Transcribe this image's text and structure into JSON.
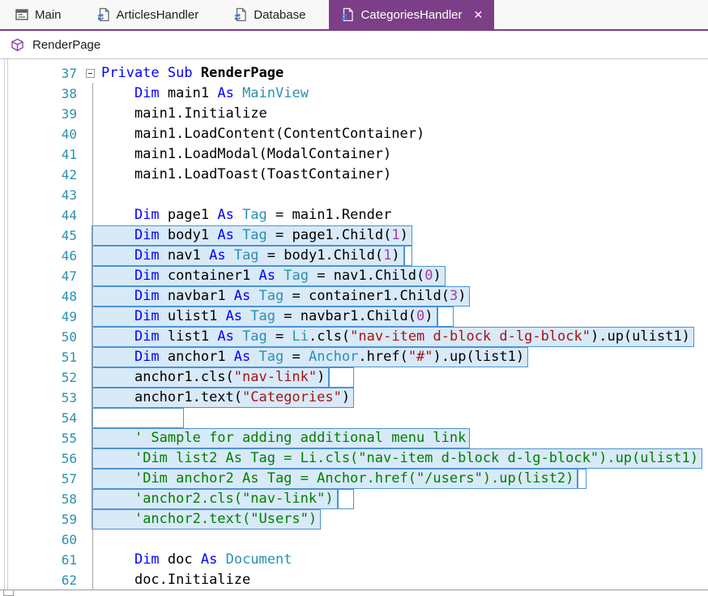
{
  "chrome": {
    "close_glyph": "✕"
  },
  "colors": {
    "accent": "#7C3E86",
    "kw": "#0000FF",
    "ty": "#2B91AF",
    "st": "#A31515",
    "cm": "#008000",
    "nm": "#A23DA0",
    "line_no": "#2B91AF",
    "sel_fill": "#D8E9F8",
    "sel_border": "#4B93D4"
  },
  "tabs": [
    {
      "label": "Main",
      "icon": "form-icon",
      "active": false
    },
    {
      "label": "ArticlesHandler",
      "icon": "vb-file-icon",
      "active": false
    },
    {
      "label": "Database",
      "icon": "vb-file-icon",
      "active": false
    },
    {
      "label": "CategoriesHandler",
      "icon": "vb-file-icon",
      "active": true
    }
  ],
  "breadcrumb": {
    "label": "RenderPage",
    "icon": "method-cube-icon"
  },
  "editor": {
    "lines": [
      {
        "no": 37,
        "fold": true,
        "indent": 0,
        "sel": false,
        "tokens": [
          [
            "kw",
            "Private"
          ],
          [
            "pl",
            " "
          ],
          [
            "kw",
            "Sub"
          ],
          [
            "pl",
            " "
          ],
          [
            "bold",
            "RenderPage"
          ]
        ]
      },
      {
        "no": 38,
        "indent": 4,
        "sel": false,
        "tokens": [
          [
            "kw",
            "Dim"
          ],
          [
            "pl",
            " main1 "
          ],
          [
            "kw",
            "As"
          ],
          [
            "pl",
            " "
          ],
          [
            "ty",
            "MainView"
          ]
        ]
      },
      {
        "no": 39,
        "indent": 4,
        "sel": false,
        "tokens": [
          [
            "pl",
            "main1.Initialize"
          ]
        ]
      },
      {
        "no": 40,
        "indent": 4,
        "sel": false,
        "tokens": [
          [
            "pl",
            "main1.LoadContent(ContentContainer)"
          ]
        ]
      },
      {
        "no": 41,
        "indent": 4,
        "sel": false,
        "tokens": [
          [
            "pl",
            "main1.LoadModal(ModalContainer)"
          ]
        ]
      },
      {
        "no": 42,
        "indent": 4,
        "sel": false,
        "tokens": [
          [
            "pl",
            "main1.LoadToast(ToastContainer)"
          ]
        ]
      },
      {
        "no": 43,
        "indent": 0,
        "sel": false,
        "tokens": []
      },
      {
        "no": 44,
        "indent": 4,
        "sel": false,
        "tokens": [
          [
            "kw",
            "Dim"
          ],
          [
            "pl",
            " page1 "
          ],
          [
            "kw",
            "As"
          ],
          [
            "pl",
            " "
          ],
          [
            "ty",
            "Tag"
          ],
          [
            "pl",
            " = main1.Render"
          ]
        ]
      },
      {
        "no": 45,
        "indent": 4,
        "sel": true,
        "tokens": [
          [
            "kw",
            "Dim"
          ],
          [
            "pl",
            " body1 "
          ],
          [
            "kw",
            "As"
          ],
          [
            "pl",
            " "
          ],
          [
            "ty",
            "Tag"
          ],
          [
            "pl",
            " = page1.Child("
          ],
          [
            "nm",
            "1"
          ],
          [
            "pl",
            ")"
          ]
        ]
      },
      {
        "no": 46,
        "indent": 4,
        "sel": true,
        "notch_ch": 1,
        "tokens": [
          [
            "kw",
            "Dim"
          ],
          [
            "pl",
            " nav1 "
          ],
          [
            "kw",
            "As"
          ],
          [
            "pl",
            " "
          ],
          [
            "ty",
            "Tag"
          ],
          [
            "pl",
            " = body1.Child("
          ],
          [
            "nm",
            "1"
          ],
          [
            "pl",
            ")"
          ]
        ]
      },
      {
        "no": 47,
        "indent": 4,
        "sel": true,
        "tokens": [
          [
            "kw",
            "Dim"
          ],
          [
            "pl",
            " container1 "
          ],
          [
            "kw",
            "As"
          ],
          [
            "pl",
            " "
          ],
          [
            "ty",
            "Tag"
          ],
          [
            "pl",
            " = nav1.Child("
          ],
          [
            "nm",
            "0"
          ],
          [
            "pl",
            ")"
          ]
        ]
      },
      {
        "no": 48,
        "indent": 4,
        "sel": true,
        "tokens": [
          [
            "kw",
            "Dim"
          ],
          [
            "pl",
            " navbar1 "
          ],
          [
            "kw",
            "As"
          ],
          [
            "pl",
            " "
          ],
          [
            "ty",
            "Tag"
          ],
          [
            "pl",
            " = container1.Child("
          ],
          [
            "nm",
            "3"
          ],
          [
            "pl",
            ")"
          ]
        ]
      },
      {
        "no": 49,
        "indent": 4,
        "sel": true,
        "notch_ch": 2,
        "tokens": [
          [
            "kw",
            "Dim"
          ],
          [
            "pl",
            " ulist1 "
          ],
          [
            "kw",
            "As"
          ],
          [
            "pl",
            " "
          ],
          [
            "ty",
            "Tag"
          ],
          [
            "pl",
            " = navbar1.Child("
          ],
          [
            "nm",
            "0"
          ],
          [
            "pl",
            ")"
          ]
        ]
      },
      {
        "no": 50,
        "indent": 4,
        "sel": true,
        "tokens": [
          [
            "kw",
            "Dim"
          ],
          [
            "pl",
            " list1 "
          ],
          [
            "kw",
            "As"
          ],
          [
            "pl",
            " "
          ],
          [
            "ty",
            "Tag"
          ],
          [
            "pl",
            " = "
          ],
          [
            "ty",
            "Li"
          ],
          [
            "pl",
            ".cls("
          ],
          [
            "st",
            "\"nav-item d-block d-lg-block\""
          ],
          [
            "pl",
            ").up(ulist1)"
          ]
        ]
      },
      {
        "no": 51,
        "indent": 4,
        "sel": true,
        "tokens": [
          [
            "kw",
            "Dim"
          ],
          [
            "pl",
            " anchor1 "
          ],
          [
            "kw",
            "As"
          ],
          [
            "pl",
            " "
          ],
          [
            "ty",
            "Tag"
          ],
          [
            "pl",
            " = "
          ],
          [
            "ty",
            "Anchor"
          ],
          [
            "pl",
            ".href("
          ],
          [
            "st",
            "\"#\""
          ],
          [
            "pl",
            ").up(list1)"
          ]
        ]
      },
      {
        "no": 52,
        "indent": 4,
        "sel": true,
        "notch_ch": 3,
        "tokens": [
          [
            "pl",
            "anchor1.cls("
          ],
          [
            "st",
            "\"nav-link\""
          ],
          [
            "pl",
            ")"
          ]
        ]
      },
      {
        "no": 53,
        "indent": 4,
        "sel": true,
        "tokens": [
          [
            "pl",
            "anchor1.text("
          ],
          [
            "st",
            "\"Categories\""
          ],
          [
            "pl",
            ")"
          ]
        ]
      },
      {
        "no": 54,
        "indent": 0,
        "sel": true,
        "box_ch": 10,
        "tokens": []
      },
      {
        "no": 55,
        "indent": 4,
        "sel": true,
        "tokens": [
          [
            "cm",
            "' Sample for adding additional menu link"
          ]
        ]
      },
      {
        "no": 56,
        "indent": 4,
        "sel": true,
        "tokens": [
          [
            "cm",
            "'Dim list2 As Tag = Li.cls(\"nav-item d-block d-lg-block\").up(ulist1)"
          ]
        ]
      },
      {
        "no": 57,
        "indent": 4,
        "sel": true,
        "notch_ch": 1,
        "tokens": [
          [
            "cm",
            "'Dim anchor2 As Tag = Anchor.href(\"/users\").up(list2)"
          ]
        ]
      },
      {
        "no": 58,
        "indent": 4,
        "sel": true,
        "notch_ch": 2,
        "tokens": [
          [
            "cm",
            "'anchor2.cls(\"nav-link\")"
          ]
        ]
      },
      {
        "no": 59,
        "indent": 4,
        "sel": true,
        "tokens": [
          [
            "cm",
            "'anchor2.text(\"Users\")"
          ]
        ]
      },
      {
        "no": 60,
        "indent": 0,
        "sel": false,
        "tokens": []
      },
      {
        "no": 61,
        "indent": 4,
        "sel": false,
        "tokens": [
          [
            "kw",
            "Dim"
          ],
          [
            "pl",
            " doc "
          ],
          [
            "kw",
            "As"
          ],
          [
            "pl",
            " "
          ],
          [
            "ty",
            "Document"
          ]
        ]
      },
      {
        "no": 62,
        "indent": 4,
        "sel": false,
        "tokens": [
          [
            "pl",
            "doc.Initialize"
          ]
        ]
      }
    ]
  }
}
